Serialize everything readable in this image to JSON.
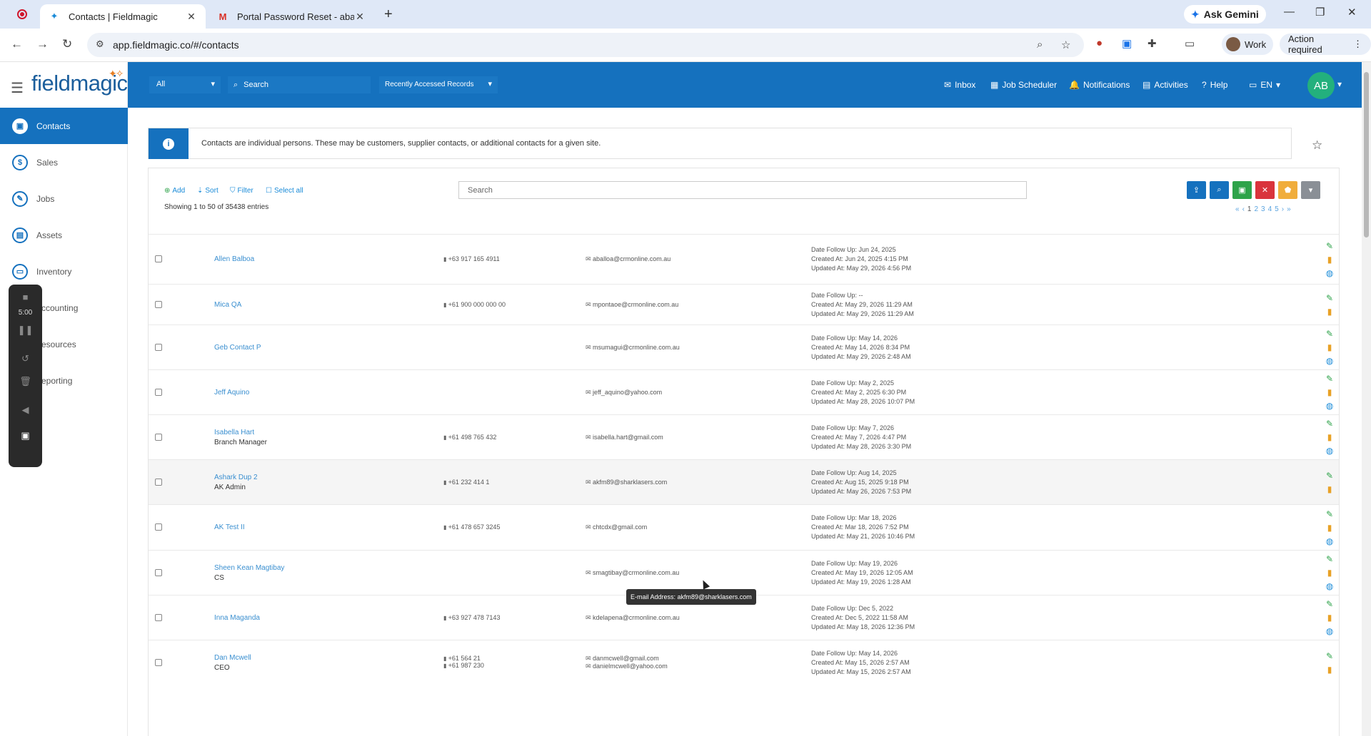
{
  "browser": {
    "tabs": [
      {
        "title": "Contacts | Fieldmagic",
        "active": true
      },
      {
        "title": "Portal Password Reset - abalboa",
        "active": false
      }
    ],
    "gemini_label": "Ask Gemini",
    "url": "app.fieldmagic.co/#/contacts",
    "profile_label": "Work",
    "action_required": "Action required"
  },
  "app": {
    "logo": "fieldmagic",
    "sidebar": [
      {
        "label": "Contacts",
        "icon": "contacts-icon",
        "glyph": "▣"
      },
      {
        "label": "Sales",
        "icon": "dollar-icon",
        "glyph": "$"
      },
      {
        "label": "Jobs",
        "icon": "wrench-icon",
        "glyph": "✎"
      },
      {
        "label": "Assets",
        "icon": "briefcase-icon",
        "glyph": "▤"
      },
      {
        "label": "Inventory",
        "icon": "inventory-icon",
        "glyph": "▭"
      },
      {
        "label": "ccounting",
        "icon": "accounting-icon",
        "glyph": ""
      },
      {
        "label": "esources",
        "icon": "resources-icon",
        "glyph": ""
      },
      {
        "label": "eporting",
        "icon": "reporting-icon",
        "glyph": ""
      }
    ],
    "recorder_time": "5:00",
    "topbar": {
      "filter_value": "All",
      "search_placeholder": "Search",
      "recent_label": "Recently Accessed Records",
      "links": [
        "Inbox",
        "Job Scheduler",
        "Notifications",
        "Activities",
        "Help",
        "EN"
      ],
      "avatar": "AB"
    },
    "info_text": "Contacts are individual persons. These may be customers, supplier contacts, or additional contacts for a given site.",
    "list": {
      "actions": {
        "add": "Add",
        "sort": "Sort",
        "filter": "Filter",
        "select_all": "Select all"
      },
      "showing": "Showing 1 to 50 of 35438 entries",
      "search_placeholder": "Search",
      "pages": [
        "1",
        "2",
        "3",
        "4",
        "5"
      ]
    },
    "tooltip": "E-mail Address: akfm89@sharklasers.com"
  },
  "contacts": [
    {
      "name": "Allen Balboa",
      "role": "",
      "phones": [
        "+63 917 165 4911"
      ],
      "emails": [
        "aballoa@crmonline.com.au"
      ],
      "dates": [
        "Date Follow Up: Jun 24, 2025",
        "Created At: Jun 24, 2025 4:15 PM",
        "Updated At: May 29, 2026 4:56 PM"
      ],
      "globe": true
    },
    {
      "name": "Mica QA",
      "role": "",
      "phones": [
        "+61 900 000 000 00"
      ],
      "emails": [
        "mpontaoe@crmonline.com.au"
      ],
      "dates": [
        "Date Follow Up: --",
        "Created At: May 29, 2026 11:29 AM",
        "Updated At: May 29, 2026 11:29 AM"
      ],
      "globe": false
    },
    {
      "name": "Geb Contact P",
      "role": "",
      "phones": [],
      "emails": [
        "msumagui@crmonline.com.au"
      ],
      "dates": [
        "Date Follow Up: May 14, 2026",
        "Created At: May 14, 2026 8:34 PM",
        "Updated At: May 29, 2026 2:48 AM"
      ],
      "globe": true
    },
    {
      "name": "Jeff Aquino",
      "role": "",
      "phones": [],
      "emails": [
        "jeff_aquino@yahoo.com"
      ],
      "dates": [
        "Date Follow Up: May 2, 2025",
        "Created At: May 2, 2025 6:30 PM",
        "Updated At: May 28, 2026 10:07 PM"
      ],
      "globe": true
    },
    {
      "name": "Isabella Hart",
      "role": "Branch Manager",
      "phones": [
        "+61 498 765 432"
      ],
      "emails": [
        "isabella.hart@gmail.com"
      ],
      "dates": [
        "Date Follow Up: May 7, 2026",
        "Created At: May 7, 2026 4:47 PM",
        "Updated At: May 28, 2026 3:30 PM"
      ],
      "globe": true
    },
    {
      "name": "Ashark Dup 2",
      "role": "AK Admin",
      "phones": [
        "+61 232 414 1"
      ],
      "emails": [
        "akfm89@sharklasers.com"
      ],
      "dates": [
        "Date Follow Up: Aug 14, 2025",
        "Created At: Aug 15, 2025 9:18 PM",
        "Updated At: May 26, 2026 7:53 PM"
      ],
      "globe": false
    },
    {
      "name": "AK Test II",
      "role": "",
      "phones": [
        "+61 478 657 3245"
      ],
      "emails": [
        "chtcdx@gmail.com"
      ],
      "dates": [
        "Date Follow Up: Mar 18, 2026",
        "Created At: Mar 18, 2026 7:52 PM",
        "Updated At: May 21, 2026 10:46 PM"
      ],
      "globe": true
    },
    {
      "name": "Sheen Kean Magtibay",
      "role": "CS",
      "phones": [],
      "emails": [
        "smagtibay@crmonline.com.au"
      ],
      "dates": [
        "Date Follow Up: May 19, 2026",
        "Created At: May 19, 2026 12:05 AM",
        "Updated At: May 19, 2026 1:28 AM"
      ],
      "globe": true
    },
    {
      "name": "Inna Maganda",
      "role": "",
      "phones": [
        "+63 927 478 7143"
      ],
      "emails": [
        "kdelapena@crmonline.com.au"
      ],
      "dates": [
        "Date Follow Up: Dec 5, 2022",
        "Created At: Dec 5, 2022 11:58 AM",
        "Updated At: May 18, 2026 12:36 PM"
      ],
      "globe": true
    },
    {
      "name": "Dan Mcwell",
      "role": "CEO",
      "phones": [
        "+61 564 21",
        "+61 987 230"
      ],
      "emails": [
        "danmcwell@gmail.com",
        "danielmcwell@yahoo.com"
      ],
      "dates": [
        "Date Follow Up: May 14, 2026",
        "Created At: May 15, 2026 2:57 AM",
        "Updated At: May 15, 2026 2:57 AM"
      ],
      "globe": false
    }
  ]
}
